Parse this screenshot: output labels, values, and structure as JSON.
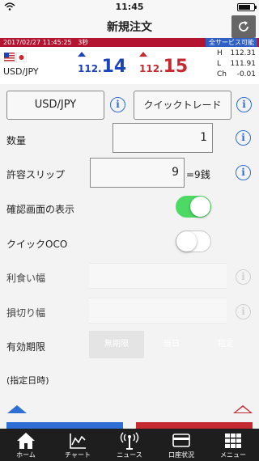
{
  "status": {
    "time": "11:45"
  },
  "nav": {
    "title": "新規注文",
    "refresh_icon": "refresh-icon"
  },
  "info": {
    "timestamp": "2017/02/27 11:45:25",
    "interval": "3秒",
    "service": "全サービス可能"
  },
  "quote": {
    "pair": "USD/JPY",
    "bid": {
      "small": "112.",
      "large": "14"
    },
    "ask": {
      "small": "112.",
      "large": "15"
    },
    "high_label": "H",
    "high": "112.31",
    "low_label": "L",
    "low": "111.91",
    "change_label": "Ch",
    "change": "-0.01",
    "colors": {
      "bid": "#1c43b8",
      "ask": "#c42a30"
    }
  },
  "order": {
    "pair_button": "USD/JPY",
    "mode_button": "クイックトレード",
    "quantity_label": "数量",
    "quantity_value": "1",
    "slippage_label": "許容スリップ",
    "slippage_value": "9",
    "slippage_unit": "=9銭",
    "confirm_label": "確認画面の表示",
    "confirm_on": true,
    "quick_oco_label": "クイックOCO",
    "quick_oco_on": false,
    "take_profit_label": "利食い幅",
    "stop_loss_label": "損切り幅",
    "expiry_label": "有効期限",
    "expiry_options": [
      "無期限",
      "当日",
      "指定"
    ],
    "expiry_selected": "無期限",
    "specified_datetime_label": "(指定日時)"
  },
  "tabs": [
    {
      "label": "ホーム",
      "icon": "home-icon"
    },
    {
      "label": "チャート",
      "icon": "chart-icon"
    },
    {
      "label": "ニュース",
      "icon": "news-icon"
    },
    {
      "label": "口座状況",
      "icon": "account-icon"
    },
    {
      "label": "メニュー",
      "icon": "menu-grid-icon"
    }
  ]
}
